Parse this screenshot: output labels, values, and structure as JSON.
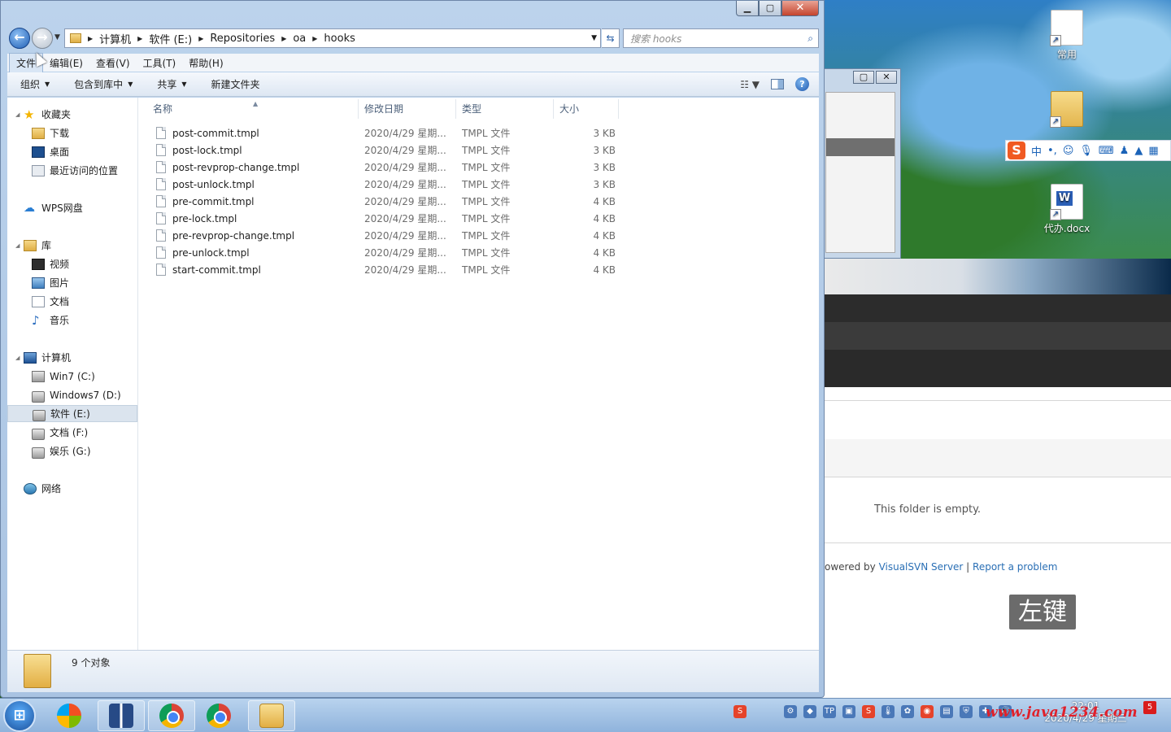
{
  "window": {
    "controls": {
      "minimize": "▁",
      "maximize": "▢",
      "close": "✕"
    }
  },
  "address_bar": {
    "breadcrumbs": [
      "计算机",
      "软件 (E:)",
      "Repositories",
      "oa",
      "hooks"
    ],
    "search_placeholder": "搜索 hooks"
  },
  "menu": [
    "文件",
    "编辑(E)",
    "查看(V)",
    "工具(T)",
    "帮助(H)"
  ],
  "toolbar": {
    "organize": "组织",
    "include_in_library": "包含到库中",
    "share": "共享",
    "new_folder": "新建文件夹"
  },
  "nav_pane": {
    "favorites": "收藏夹",
    "downloads": "下载",
    "desktop": "桌面",
    "recent": "最近访问的位置",
    "wps_cloud": "WPS网盘",
    "libraries": "库",
    "videos": "视频",
    "pictures": "图片",
    "documents": "文档",
    "music": "音乐",
    "computer": "计算机",
    "drive_c": "Win7 (C:)",
    "drive_d": "Windows7 (D:)",
    "drive_e": "软件 (E:)",
    "drive_f": "文档 (F:)",
    "drive_g": "娱乐 (G:)",
    "network": "网络"
  },
  "columns": {
    "name": "名称",
    "modified": "修改日期",
    "type": "类型",
    "size": "大小"
  },
  "files": [
    {
      "name": "post-commit.tmpl",
      "modified": "2020/4/29 星期...",
      "type": "TMPL 文件",
      "size": "3 KB"
    },
    {
      "name": "post-lock.tmpl",
      "modified": "2020/4/29 星期...",
      "type": "TMPL 文件",
      "size": "3 KB"
    },
    {
      "name": "post-revprop-change.tmpl",
      "modified": "2020/4/29 星期...",
      "type": "TMPL 文件",
      "size": "3 KB"
    },
    {
      "name": "post-unlock.tmpl",
      "modified": "2020/4/29 星期...",
      "type": "TMPL 文件",
      "size": "3 KB"
    },
    {
      "name": "pre-commit.tmpl",
      "modified": "2020/4/29 星期...",
      "type": "TMPL 文件",
      "size": "4 KB"
    },
    {
      "name": "pre-lock.tmpl",
      "modified": "2020/4/29 星期...",
      "type": "TMPL 文件",
      "size": "4 KB"
    },
    {
      "name": "pre-revprop-change.tmpl",
      "modified": "2020/4/29 星期...",
      "type": "TMPL 文件",
      "size": "4 KB"
    },
    {
      "name": "pre-unlock.tmpl",
      "modified": "2020/4/29 星期...",
      "type": "TMPL 文件",
      "size": "4 KB"
    },
    {
      "name": "start-commit.tmpl",
      "modified": "2020/4/29 星期...",
      "type": "TMPL 文件",
      "size": "4 KB"
    }
  ],
  "details_pane": {
    "count": "9 个对象"
  },
  "desktop": {
    "icon_common": "常用",
    "icon_todo": "代办.docx"
  },
  "web_page": {
    "empty_message": "This folder is empty.",
    "footer_prefix": "owered by ",
    "footer_link1": "VisualSVN Server",
    "footer_sep": " | ",
    "footer_link2": "Report a problem"
  },
  "ime": {
    "logo": "S",
    "mode": "中"
  },
  "click_hint": "左键",
  "taskbar": {
    "clock_time": "22:01",
    "clock_date": "2020/4/29 星期三"
  },
  "watermark": "www.java1234.com",
  "colors": {
    "accent": "#2a6fb5",
    "watermark": "#e0202a"
  }
}
